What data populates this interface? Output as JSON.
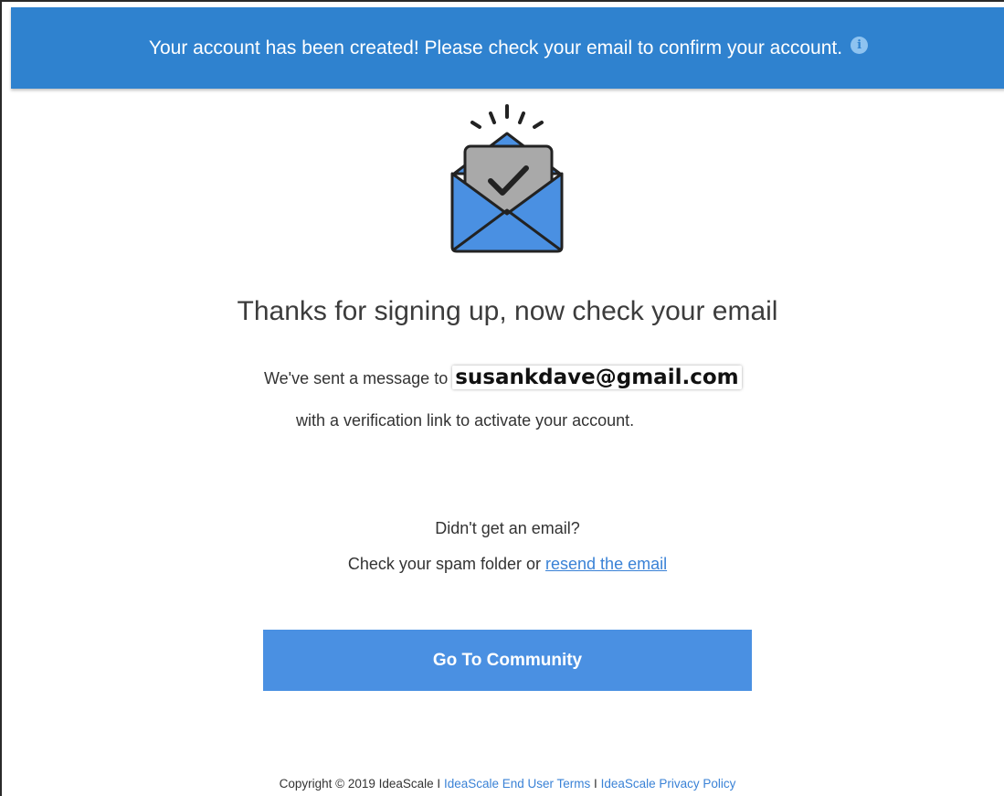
{
  "banner": {
    "message": "Your account has been created! Please check your email to confirm your account.",
    "icon": "info-icon",
    "icon_glyph": "i",
    "background_color": "#2f82cf"
  },
  "illustration": {
    "icon": "envelope-check-icon"
  },
  "main": {
    "heading": "Thanks for signing up, now check your email",
    "sent_prefix": "We've sent a message to",
    "email": "susankdave@gmail.com",
    "verification_text": "with a verification link to activate your account.",
    "didnt_get": "Didn't get an email?",
    "spam_prefix": "Check your spam folder or",
    "resend_link": "resend the email"
  },
  "cta": {
    "label": "Go To Community",
    "color": "#4a90e2"
  },
  "footer": {
    "copyright": "Copyright © 2019 IdeaScale",
    "separator": "I",
    "terms_link": "IdeaScale End User Terms",
    "privacy_link": "IdeaScale Privacy Policy",
    "link_color": "#3a82d6"
  }
}
